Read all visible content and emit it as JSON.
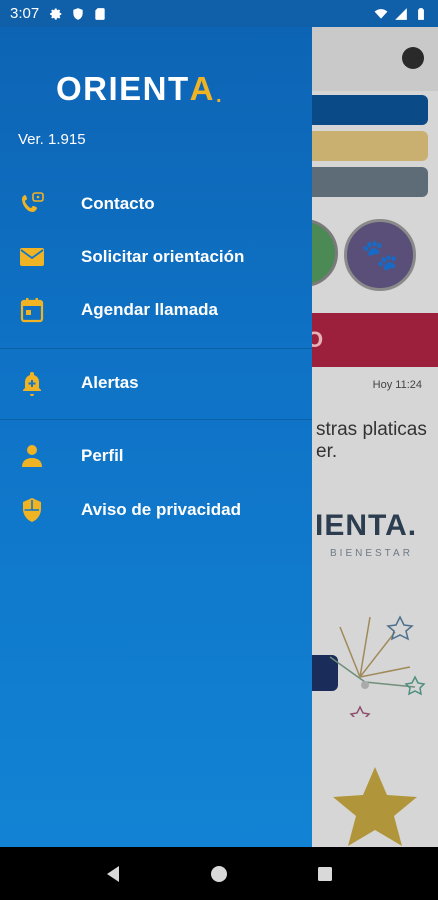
{
  "status_bar": {
    "time": "3:07",
    "left_icons": [
      "gear-icon",
      "shield-icon",
      "sd-card-icon"
    ],
    "right_icons": [
      "wifi-icon",
      "signal-icon",
      "battery-icon"
    ]
  },
  "drawer": {
    "logo": {
      "main": "ORIENT",
      "accent": "A",
      "dot": "."
    },
    "version": "Ver. 1.915",
    "items": [
      {
        "label": "Contacto",
        "icon": "phone-chat-icon"
      },
      {
        "label": "Solicitar orientación",
        "icon": "envelope-icon"
      },
      {
        "label": "Agendar llamada",
        "icon": "calendar-icon"
      },
      {
        "label": "Alertas",
        "icon": "bell-plus-icon"
      },
      {
        "label": "Perfil",
        "icon": "person-icon"
      },
      {
        "label": "Aviso de privacidad",
        "icon": "shield-icon"
      }
    ]
  },
  "background": {
    "banner_text": "O",
    "timestamp": "Hoy 11:24",
    "message_line1": "stras platicas",
    "message_line2": "er.",
    "brand": "IENTA.",
    "brand_sub": "BIENESTAR"
  },
  "colors": {
    "drawer_top": "#0d63b3",
    "drawer_bottom": "#1283d4",
    "accent_yellow": "#f0b323"
  }
}
